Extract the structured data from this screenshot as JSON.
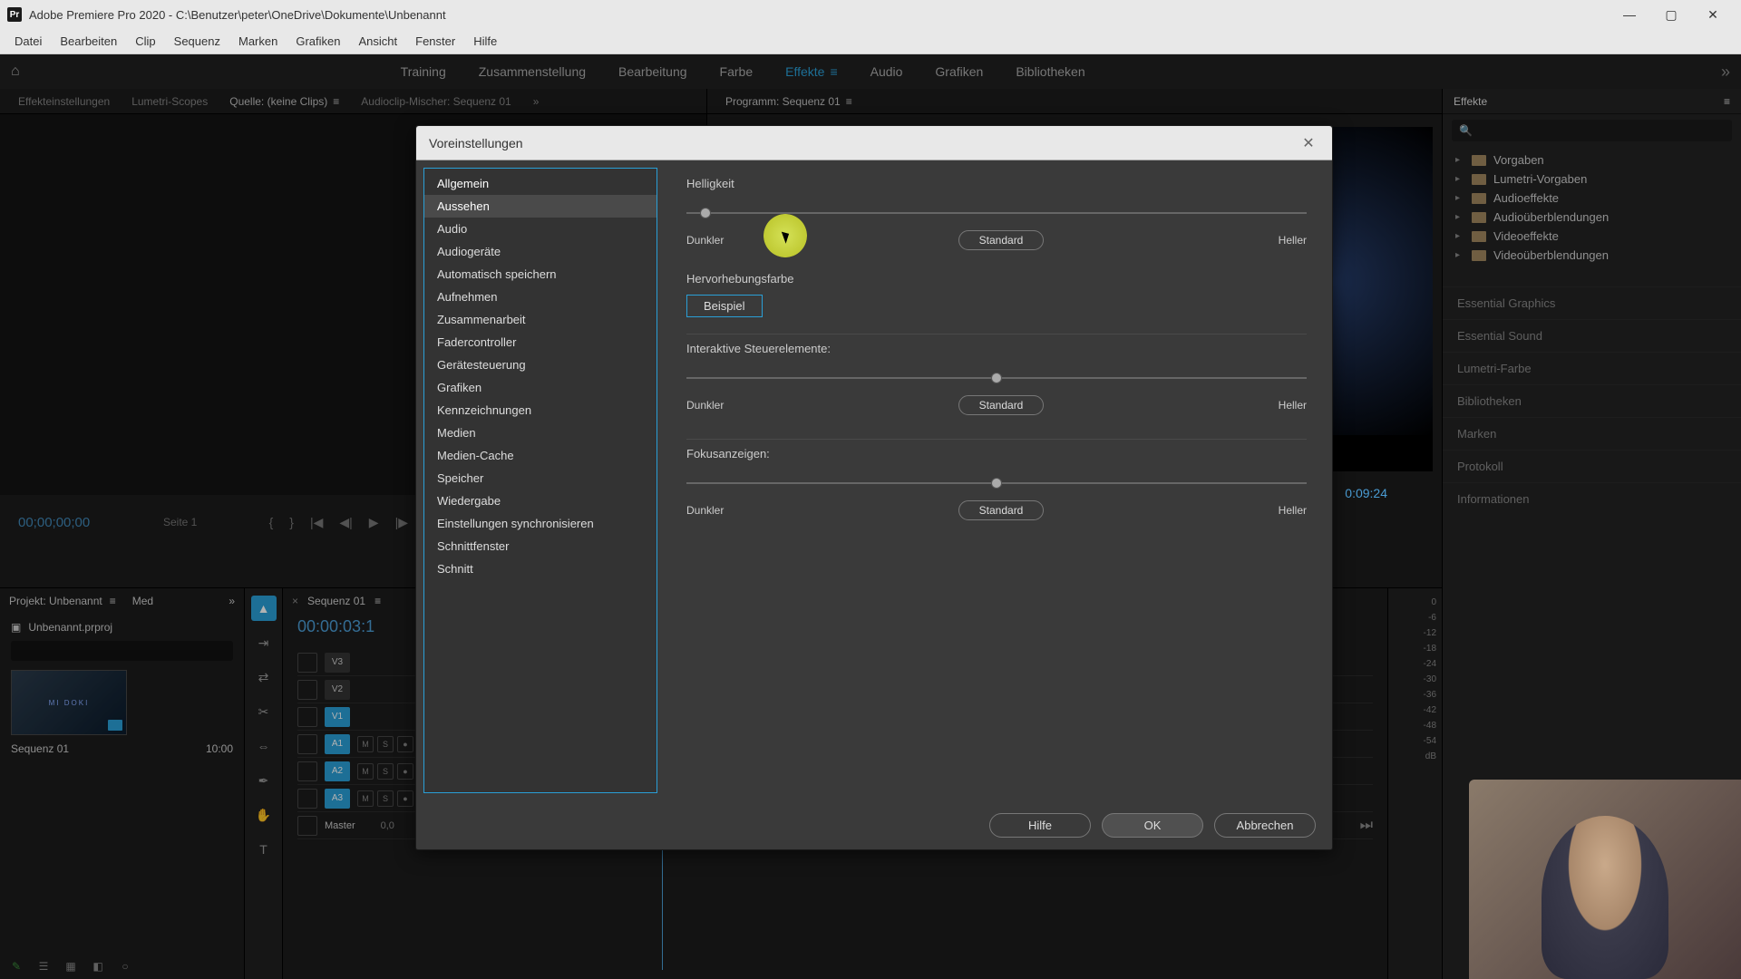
{
  "titlebar": {
    "app_initials": "Pr",
    "title": "Adobe Premiere Pro 2020 - C:\\Benutzer\\peter\\OneDrive\\Dokumente\\Unbenannt"
  },
  "menubar": [
    "Datei",
    "Bearbeiten",
    "Clip",
    "Sequenz",
    "Marken",
    "Grafiken",
    "Ansicht",
    "Fenster",
    "Hilfe"
  ],
  "workspaces": [
    "Training",
    "Zusammenstellung",
    "Bearbeitung",
    "Farbe",
    "Effekte",
    "Audio",
    "Grafiken",
    "Bibliotheken"
  ],
  "workspace_active_index": 4,
  "panel_tabs_left": [
    "Effekteinstellungen",
    "Lumetri-Scopes",
    "Quelle: (keine Clips)",
    "Audioclip-Mischer: Sequenz 01"
  ],
  "panel_tabs_right": [
    "Programm: Sequenz 01"
  ],
  "source": {
    "timecode": "00;00;00;00",
    "page": "Seite 1"
  },
  "program": {
    "timecode": "0:09:24"
  },
  "effects": {
    "title": "Effekte",
    "search_placeholder": "",
    "tree": [
      "Vorgaben",
      "Lumetri-Vorgaben",
      "Audioeffekte",
      "Audioüberblendungen",
      "Videoeffekte",
      "Videoüberblendungen"
    ],
    "accordion": [
      "Essential Graphics",
      "Essential Sound",
      "Lumetri-Farbe",
      "Bibliotheken",
      "Marken",
      "Protokoll",
      "Informationen"
    ]
  },
  "project": {
    "tab": "Projekt: Unbenannt",
    "media_tab": "Med",
    "name": "Unbenannt.prproj",
    "thumb_label": "Sequenz 01",
    "thumb_duration": "10:00"
  },
  "timeline": {
    "tab": "Sequenz 01",
    "timecode": "00:00:03:1",
    "tracks_v": [
      "V3",
      "V2",
      "V1"
    ],
    "tracks_a": [
      "A1",
      "A2",
      "A3"
    ],
    "master": "Master",
    "master_val": "0,0"
  },
  "meter_db": [
    "0",
    "-6",
    "-12",
    "-18",
    "-24",
    "-30",
    "-36",
    "-42",
    "-48",
    "-54",
    "dB"
  ],
  "prefs": {
    "title": "Voreinstellungen",
    "categories": [
      "Allgemein",
      "Aussehen",
      "Audio",
      "Audiogeräte",
      "Automatisch speichern",
      "Aufnehmen",
      "Zusammenarbeit",
      "Fadercontroller",
      "Gerätesteuerung",
      "Grafiken",
      "Kennzeichnungen",
      "Medien",
      "Medien-Cache",
      "Speicher",
      "Wiedergabe",
      "Einstellungen synchronisieren",
      "Schnittfenster",
      "Schnitt"
    ],
    "selected_index": 1,
    "brightness_label": "Helligkeit",
    "darker": "Dunkler",
    "lighter": "Heller",
    "standard": "Standard",
    "highlight_label": "Hervorhebungsfarbe",
    "sample": "Beispiel",
    "interactive_label": "Interaktive Steuerelemente:",
    "focus_label": "Fokusanzeigen:",
    "help": "Hilfe",
    "ok": "OK",
    "cancel": "Abbrechen"
  }
}
